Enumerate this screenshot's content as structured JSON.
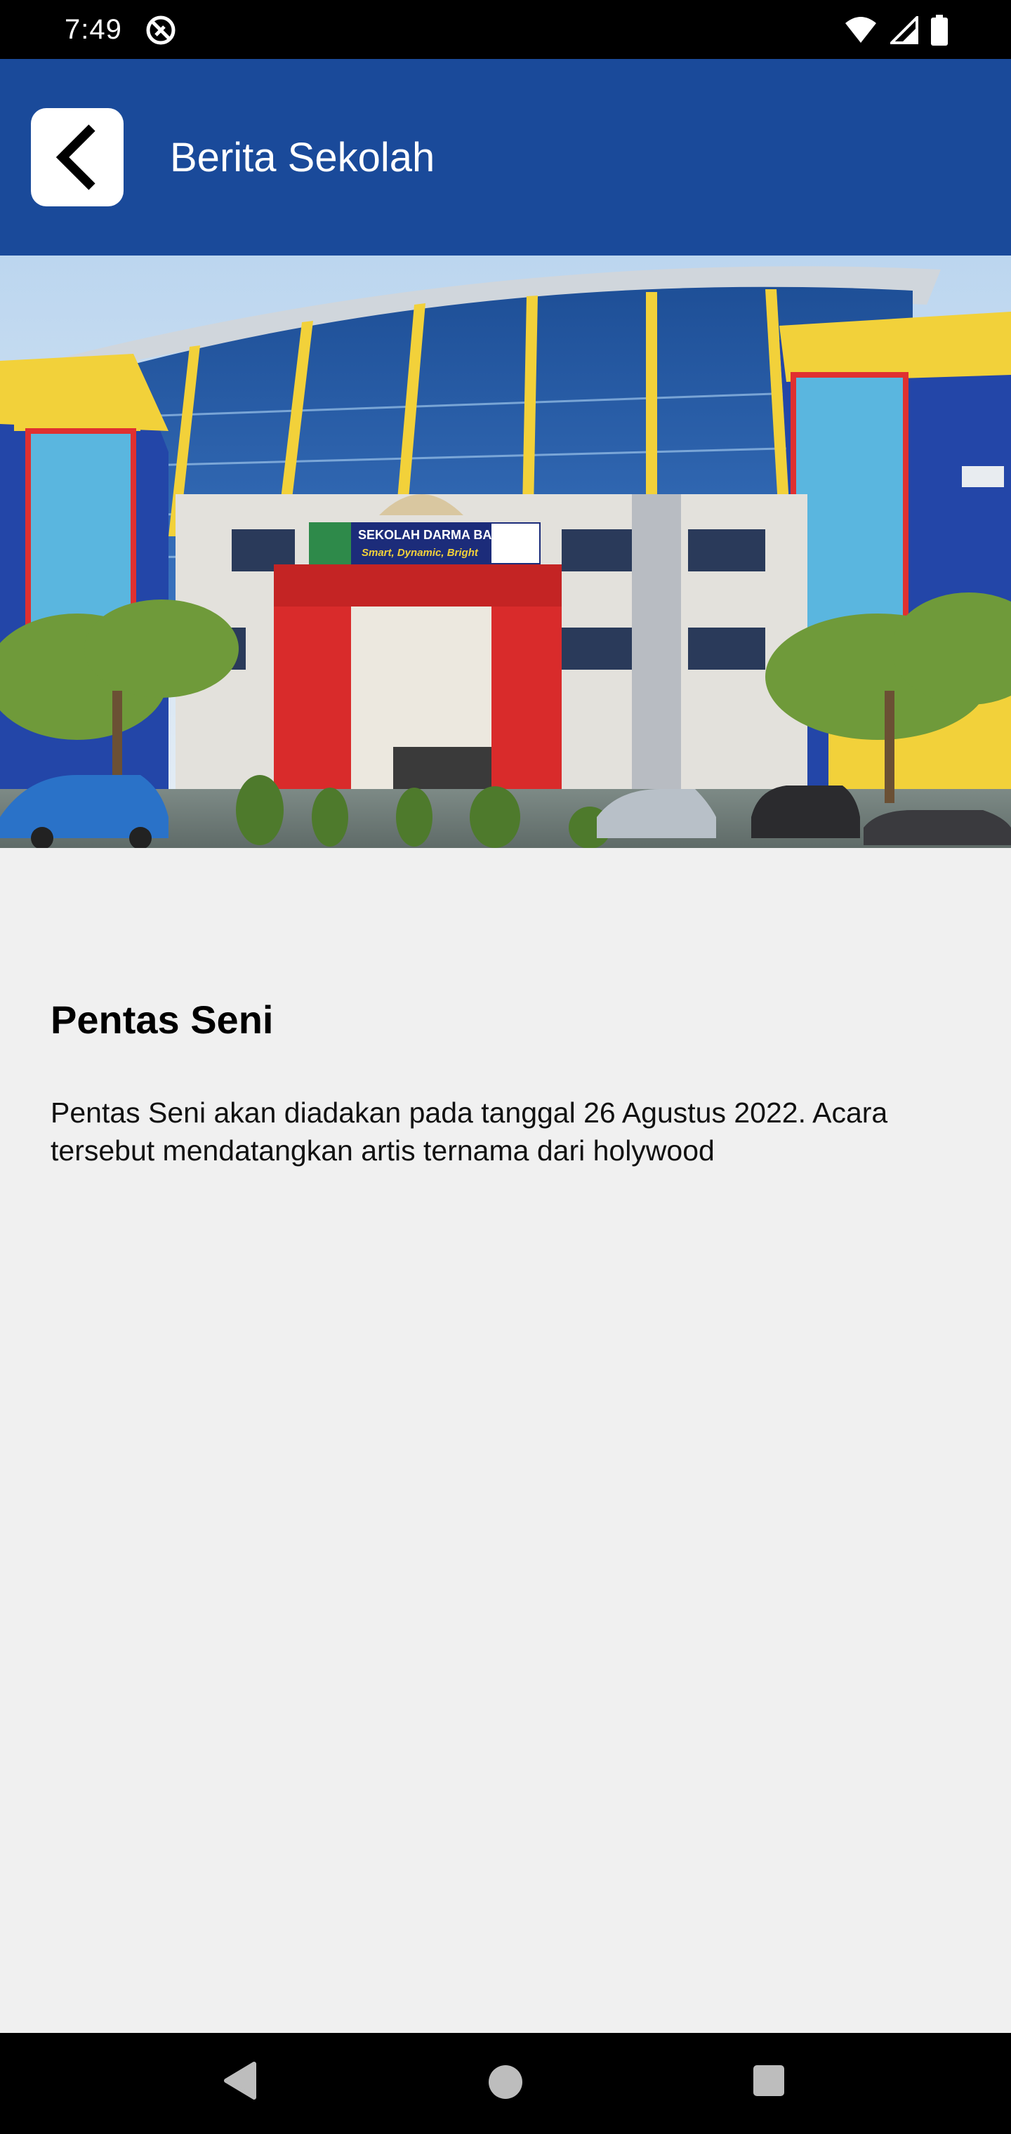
{
  "status_bar": {
    "time": "7:49",
    "icons": [
      "sync-off-icon",
      "wifi-icon",
      "signal-icon",
      "battery-icon"
    ]
  },
  "app_bar": {
    "title": "Berita Sekolah",
    "back_icon": "chevron-left-icon",
    "background_color": "#1a4a9a"
  },
  "hero_image": {
    "banner_line1": "SEKOLAH DARMA BANGSA",
    "banner_line2": "Smart, Dynamic, Bright"
  },
  "article": {
    "title": "Pentas Seni",
    "body": "Pentas Seni akan diadakan pada tanggal 26 Agustus 2022. Acara tersebut mendatangkan artis ternama dari holywood"
  },
  "nav_bar": {
    "buttons": [
      "back-triangle-icon",
      "home-circle-icon",
      "recents-square-icon"
    ]
  }
}
